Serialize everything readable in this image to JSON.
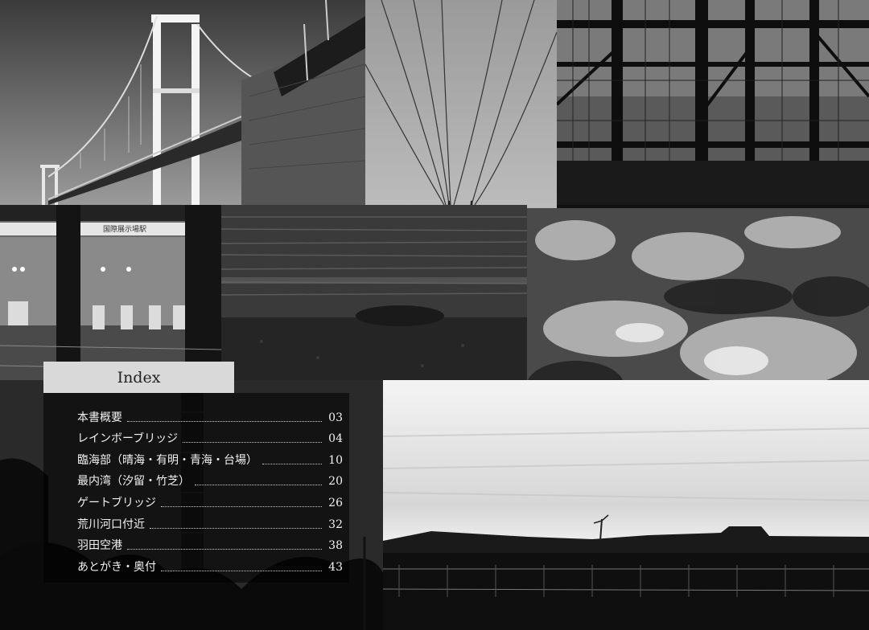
{
  "index": {
    "heading": "Index",
    "entries": [
      {
        "title": "本書概要",
        "page": "03"
      },
      {
        "title": "レインボーブリッジ",
        "page": "04"
      },
      {
        "title": "臨海部（晴海・有明・青海・台場）",
        "page": "10"
      },
      {
        "title": "最内湾（汐留・竹芝）",
        "page": "20"
      },
      {
        "title": "ゲートブリッジ",
        "page": "26"
      },
      {
        "title": "荒川河口付近",
        "page": "32"
      },
      {
        "title": "羽田空港",
        "page": "38"
      },
      {
        "title": "あとがき・奥付",
        "page": "43"
      }
    ]
  },
  "station_sign": "国際展示場駅",
  "colors": {
    "title_bar": "#d9d9d9",
    "text": "#f2f2f2",
    "panel": "#000000"
  }
}
